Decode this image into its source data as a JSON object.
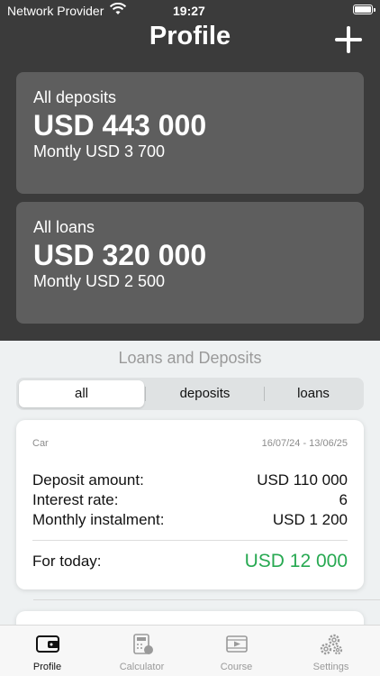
{
  "status": {
    "carrier": "Network Provider",
    "time": "19:27"
  },
  "header": {
    "title": "Profile"
  },
  "summary": {
    "deposits": {
      "label": "All deposits",
      "amount": "USD 443 000",
      "monthly": "Montly USD 3 700"
    },
    "loans": {
      "label": "All loans",
      "amount": "USD 320 000",
      "monthly": "Montly USD 2 500"
    }
  },
  "section": {
    "title": "Loans and Deposits"
  },
  "filter": {
    "options": [
      "all",
      "deposits",
      "loans"
    ],
    "selected": "all"
  },
  "items": [
    {
      "name": "Car",
      "period": "16/07/24 - 13/06/25",
      "rows": [
        {
          "label": "Deposit amount:",
          "value": "USD 110 000"
        },
        {
          "label": "Interest rate:",
          "value": "6"
        },
        {
          "label": "Monthly instalment:",
          "value": "USD 1 200"
        }
      ],
      "today": {
        "label": "For today:",
        "value": "USD 12 000"
      }
    }
  ],
  "tabs": [
    {
      "label": "Profile",
      "icon": "wallet-icon",
      "active": true
    },
    {
      "label": "Calculator",
      "icon": "calculator-icon",
      "active": false
    },
    {
      "label": "Course",
      "icon": "course-icon",
      "active": false
    },
    {
      "label": "Settings",
      "icon": "settings-icon",
      "active": false
    }
  ],
  "colors": {
    "positive": "#28a952",
    "header_bg": "#3b3b3b",
    "card_bg": "#5e5e5e"
  }
}
